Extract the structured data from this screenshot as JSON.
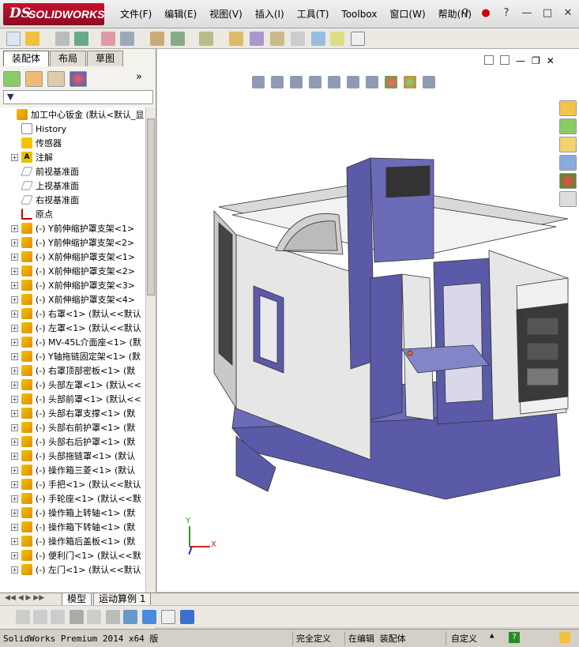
{
  "window": {
    "app_name": "SOLIDWORKS",
    "logo_mark": "DS"
  },
  "menu": [
    "文件(F)",
    "编辑(E)",
    "视图(V)",
    "插入(I)",
    "工具(T)",
    "Toolbox",
    "窗口(W)",
    "帮助(H)"
  ],
  "panel": {
    "tabs": [
      "装配体",
      "布局",
      "草图"
    ],
    "active_tab": 0,
    "tree": [
      {
        "label": "加工中心钣金  (默认<默认_显",
        "icon": "part",
        "expand": false,
        "indent": 0
      },
      {
        "label": "History",
        "icon": "hist",
        "expand": false,
        "indent": 1
      },
      {
        "label": "传感器",
        "icon": "sensor",
        "expand": false,
        "indent": 1
      },
      {
        "label": "注解",
        "icon": "note",
        "expand": true,
        "indent": 1
      },
      {
        "label": "前视基准面",
        "icon": "plane",
        "expand": false,
        "indent": 1
      },
      {
        "label": "上视基准面",
        "icon": "plane",
        "expand": false,
        "indent": 1
      },
      {
        "label": "右视基准面",
        "icon": "plane",
        "expand": false,
        "indent": 1
      },
      {
        "label": "原点",
        "icon": "origin",
        "expand": false,
        "indent": 1
      },
      {
        "label": "(-) Y前伸缩护罩支架<1>",
        "icon": "part",
        "expand": true,
        "indent": 1
      },
      {
        "label": "(-) Y前伸缩护罩支架<2>",
        "icon": "part",
        "expand": true,
        "indent": 1
      },
      {
        "label": "(-) X前伸缩护罩支架<1>",
        "icon": "part",
        "expand": true,
        "indent": 1
      },
      {
        "label": "(-) X前伸缩护罩支架<2>",
        "icon": "part",
        "expand": true,
        "indent": 1
      },
      {
        "label": "(-) X前伸缩护罩支架<3>",
        "icon": "part",
        "expand": true,
        "indent": 1
      },
      {
        "label": "(-) X前伸缩护罩支架<4>",
        "icon": "part",
        "expand": true,
        "indent": 1
      },
      {
        "label": "(-) 右罩<1> (默认<<默认",
        "icon": "part",
        "expand": true,
        "indent": 1
      },
      {
        "label": "(-) 左罩<1> (默认<<默认",
        "icon": "part",
        "expand": true,
        "indent": 1
      },
      {
        "label": "(-) MV-45L介面座<1> (默",
        "icon": "part",
        "expand": true,
        "indent": 1
      },
      {
        "label": "(-) Y轴拖链固定架<1> (默",
        "icon": "part",
        "expand": true,
        "indent": 1
      },
      {
        "label": "(-) 右罩顶部密板<1> (默",
        "icon": "part",
        "expand": true,
        "indent": 1
      },
      {
        "label": "(-) 头部左罩<1> (默认<<",
        "icon": "part",
        "expand": true,
        "indent": 1
      },
      {
        "label": "(-) 头部前罩<1> (默认<<",
        "icon": "part",
        "expand": true,
        "indent": 1
      },
      {
        "label": "(-) 头部右罩支撑<1> (默",
        "icon": "part",
        "expand": true,
        "indent": 1
      },
      {
        "label": "(-) 头部右前护罩<1> (默",
        "icon": "part",
        "expand": true,
        "indent": 1
      },
      {
        "label": "(-) 头部右后护罩<1> (默",
        "icon": "part",
        "expand": true,
        "indent": 1
      },
      {
        "label": "(-) 头部拖链罩<1> (默认",
        "icon": "part",
        "expand": true,
        "indent": 1
      },
      {
        "label": "(-) 操作箱三菱<1> (默认",
        "icon": "part",
        "expand": true,
        "indent": 1
      },
      {
        "label": "(-) 手把<1> (默认<<默认",
        "icon": "part",
        "expand": true,
        "indent": 1
      },
      {
        "label": "(-) 手轮座<1> (默认<<默",
        "icon": "part",
        "expand": true,
        "indent": 1
      },
      {
        "label": "(-) 操作箱上转轴<1> (默",
        "icon": "part",
        "expand": true,
        "indent": 1
      },
      {
        "label": "(-) 操作箱下转轴<1> (默",
        "icon": "part",
        "expand": true,
        "indent": 1
      },
      {
        "label": "(-) 操作箱后盖板<1> (默",
        "icon": "part",
        "expand": true,
        "indent": 1
      },
      {
        "label": "(-) 便利门<1> (默认<<默",
        "icon": "part",
        "expand": true,
        "indent": 1
      },
      {
        "label": "(-) 左门<1> (默认<<默认",
        "icon": "part",
        "expand": true,
        "indent": 1
      }
    ]
  },
  "bottom_tabs": [
    "模型",
    "运动算例 1"
  ],
  "status": {
    "product": "SolidWorks Premium 2014 x64 版",
    "constraint": "完全定义",
    "edit_mode": "在编辑 装配体",
    "units": "自定义"
  },
  "colors": {
    "accent": "#c8102e",
    "machine_blue": "#5a5aa8",
    "machine_gray": "#e6e6e6"
  },
  "axes_labels": {
    "x": "X",
    "y": "Y"
  }
}
